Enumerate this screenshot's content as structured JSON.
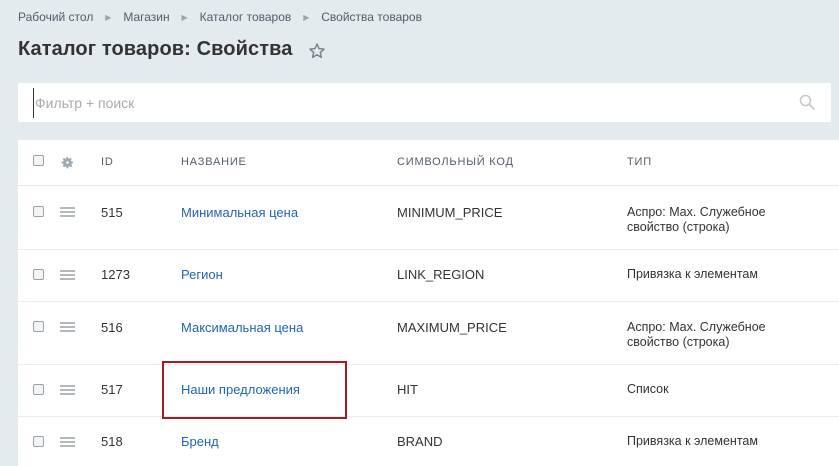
{
  "breadcrumb": {
    "items": [
      "Рабочий стол",
      "Магазин",
      "Каталог товаров",
      "Свойства товаров"
    ]
  },
  "page": {
    "title": "Каталог товаров: Свойства"
  },
  "search": {
    "placeholder": "Фильтр + поиск",
    "value": ""
  },
  "table": {
    "headers": {
      "id": "ID",
      "name": "НАЗВАНИЕ",
      "code": "СИМВОЛЬНЫЙ КОД",
      "type": "ТИП"
    },
    "rows": [
      {
        "id": "515",
        "name": "Минимальная цена",
        "code": "MINIMUM_PRICE",
        "type_line1": "Аспро: Max. Служебное",
        "type_line2": "свойство (строка)"
      },
      {
        "id": "1273",
        "name": "Регион",
        "code": "LINK_REGION",
        "type_line1": "Привязка к элементам",
        "type_line2": ""
      },
      {
        "id": "516",
        "name": "Максимальная цена",
        "code": "MAXIMUM_PRICE",
        "type_line1": "Аспро: Max. Служебное",
        "type_line2": "свойство (строка)"
      },
      {
        "id": "517",
        "name": "Наши предложения",
        "code": "HIT",
        "type_line1": "Список",
        "type_line2": ""
      },
      {
        "id": "518",
        "name": "Бренд",
        "code": "BRAND",
        "type_line1": "Привязка к элементам",
        "type_line2": ""
      }
    ]
  },
  "colors": {
    "background": "#e4ebee",
    "link": "#2067b0",
    "highlight": "#a01d24"
  },
  "icons": {
    "favorite": "star-icon",
    "search": "search-icon",
    "settings": "gear-icon",
    "drag": "drag-handle-icon"
  }
}
